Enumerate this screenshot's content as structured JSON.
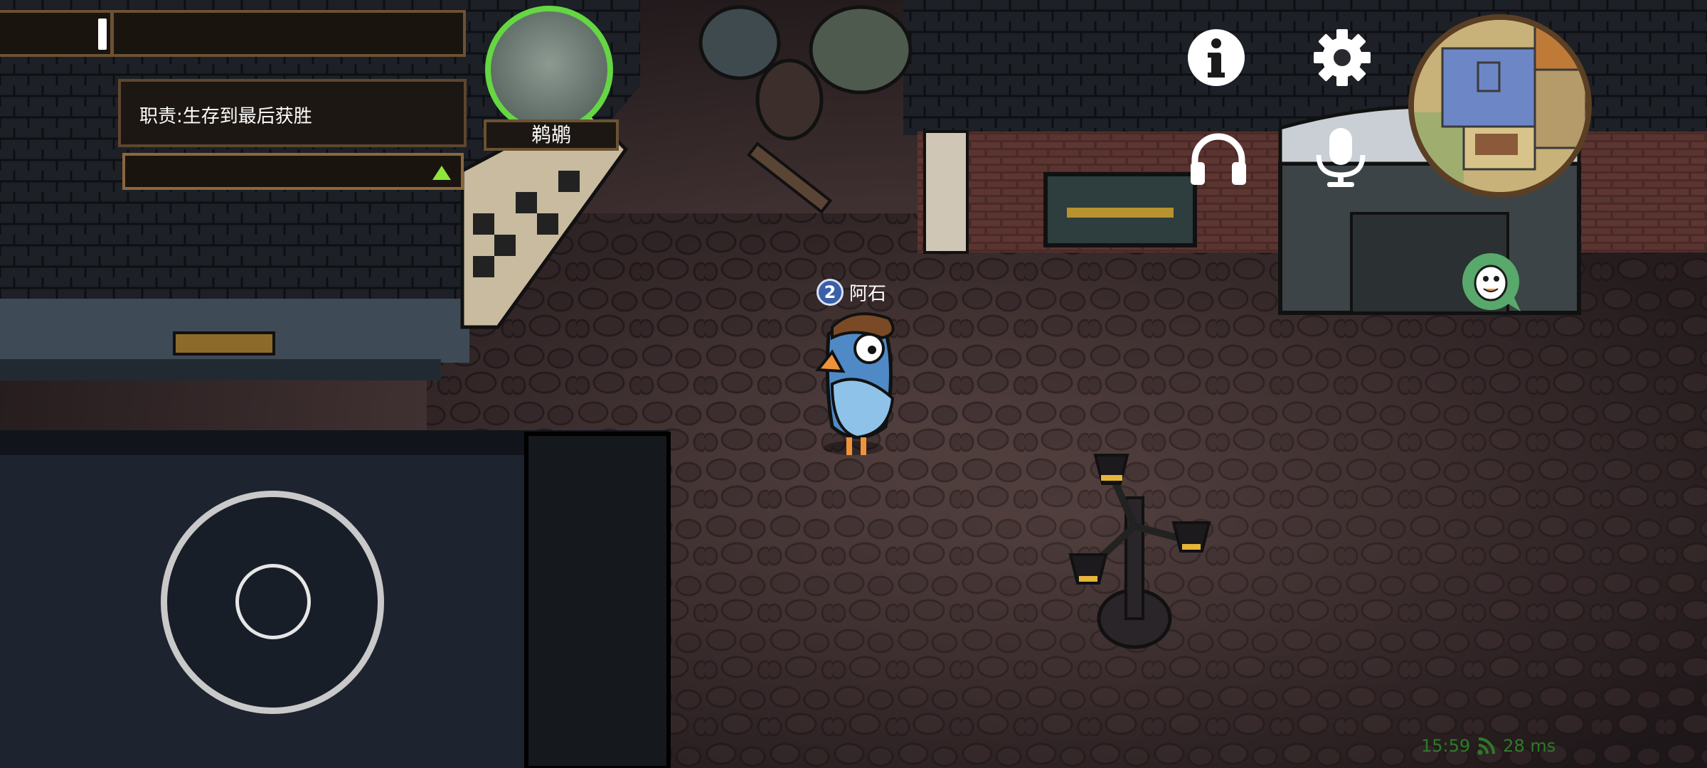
{
  "hud": {
    "duty_text": "职责:生存到最后获胜",
    "role_name": "鹈鹕",
    "player": {
      "number": "2",
      "name": "阿石"
    },
    "status": {
      "time": "15:59",
      "ping": "28 ms"
    },
    "top_progress": 0.02
  },
  "icons": {
    "info": "info-icon",
    "settings": "gear-icon",
    "headphones": "headphones-icon",
    "microphone": "microphone-icon",
    "chat": "goose-chat-icon",
    "signal": "signal-icon",
    "task_expand": "triangle-up-icon"
  },
  "colors": {
    "role_ring": "#64d743",
    "task_arrow": "#8ee63c",
    "status_text": "#2e7a2a",
    "player_badge": "#3b5fa8"
  }
}
